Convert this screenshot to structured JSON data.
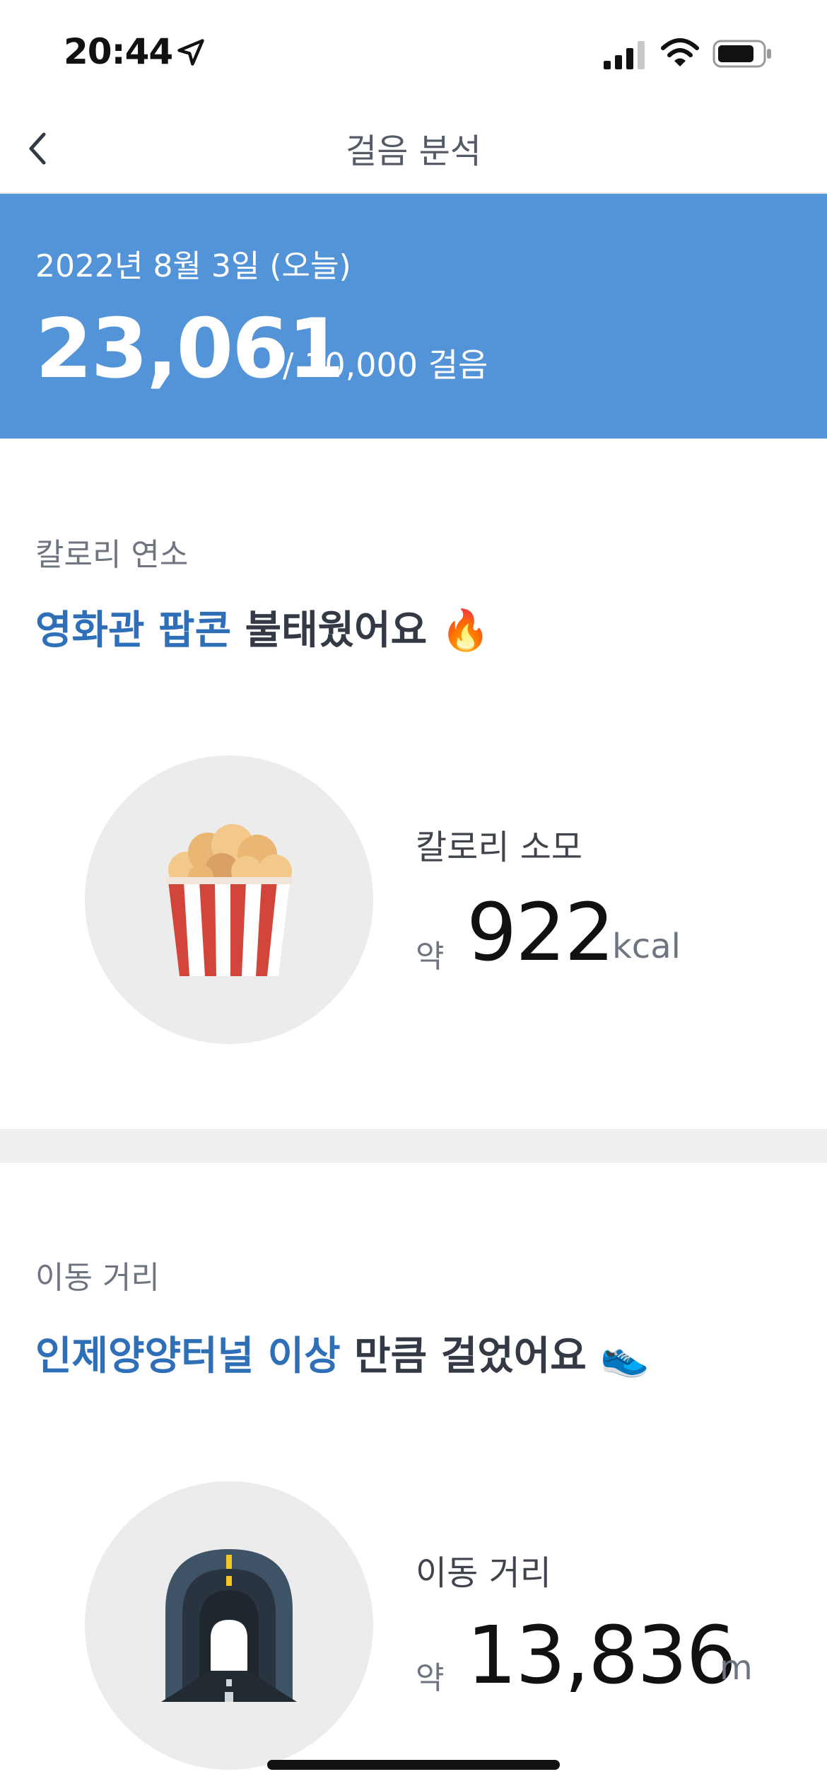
{
  "status_bar": {
    "time": "20:44",
    "icons": [
      "location-arrow-icon",
      "signal-icon",
      "wifi-icon",
      "battery-icon"
    ]
  },
  "nav": {
    "back_icon": "chevron-left-icon",
    "title": "걸음 분석"
  },
  "summary": {
    "date": "2022년 8월 3일 (오늘)",
    "steps": "23,061",
    "goal": "/ 10,000 걸음",
    "background": "#5394d8"
  },
  "calories": {
    "section_label": "칼로리 연소",
    "headline_highlight": "영화관 팝콘",
    "headline_rest": " 불태웠어요",
    "emoji": "🔥",
    "metric_label": "칼로리 소모",
    "approx": "약",
    "value": "922",
    "unit": "kcal",
    "illustration": "popcorn-icon"
  },
  "distance": {
    "section_label": "이동 거리",
    "headline_highlight": "인제양양터널 이상",
    "headline_rest": " 만큼 걸었어요",
    "emoji": "👟",
    "metric_label": "이동 거리",
    "approx": "약",
    "value": "13,836",
    "unit": "m",
    "illustration": "tunnel-icon"
  },
  "colors": {
    "accent": "#2f6fb8",
    "summary_bg": "#5394d8",
    "divider": "#efefef"
  }
}
